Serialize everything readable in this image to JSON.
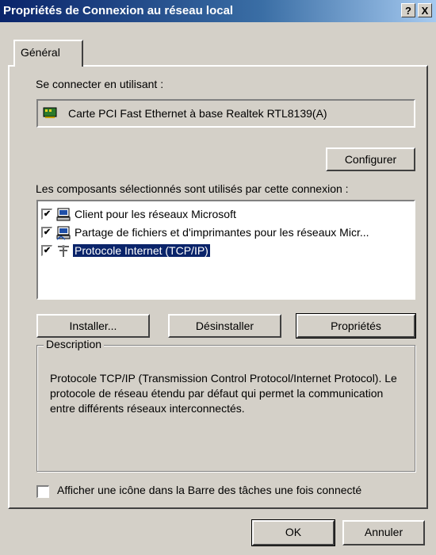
{
  "window": {
    "title": "Propriétés de Connexion au réseau local",
    "help_label": "?",
    "close_label": "X"
  },
  "tabs": [
    {
      "label": "Général"
    }
  ],
  "connect_using": {
    "label": "Se connecter en utilisant :",
    "adapter": "Carte PCI Fast Ethernet à base Realtek RTL8139(A)",
    "configure_button": "Configurer"
  },
  "components": {
    "label": "Les composants sélectionnés sont utilisés par cette connexion :",
    "items": [
      {
        "label": "Client pour les réseaux Microsoft",
        "checked": true,
        "icon": "network-client-icon",
        "selected": false
      },
      {
        "label": "Partage de fichiers et d'imprimantes pour les réseaux Micr...",
        "checked": true,
        "icon": "file-printer-sharing-icon",
        "selected": false
      },
      {
        "label": "Protocole Internet (TCP/IP)",
        "checked": true,
        "icon": "protocol-icon",
        "selected": true
      }
    ],
    "check_mark": "✔"
  },
  "actions": {
    "install": "Installer...",
    "uninstall": "Désinstaller",
    "properties": "Propriétés"
  },
  "description": {
    "legend": "Description",
    "text": "Protocole TCP/IP (Transmission Control Protocol/Internet Protocol). Le protocole de réseau étendu par défaut qui permet la communication entre différents réseaux interconnectés."
  },
  "taskbar_option": {
    "label": "Afficher une icône dans la Barre des tâches une fois connecté",
    "checked": false
  },
  "footer": {
    "ok": "OK",
    "cancel": "Annuler"
  },
  "colors": {
    "face": "#d4d0c8",
    "title_gradient_start": "#0a246a",
    "selection": "#0a246a"
  }
}
